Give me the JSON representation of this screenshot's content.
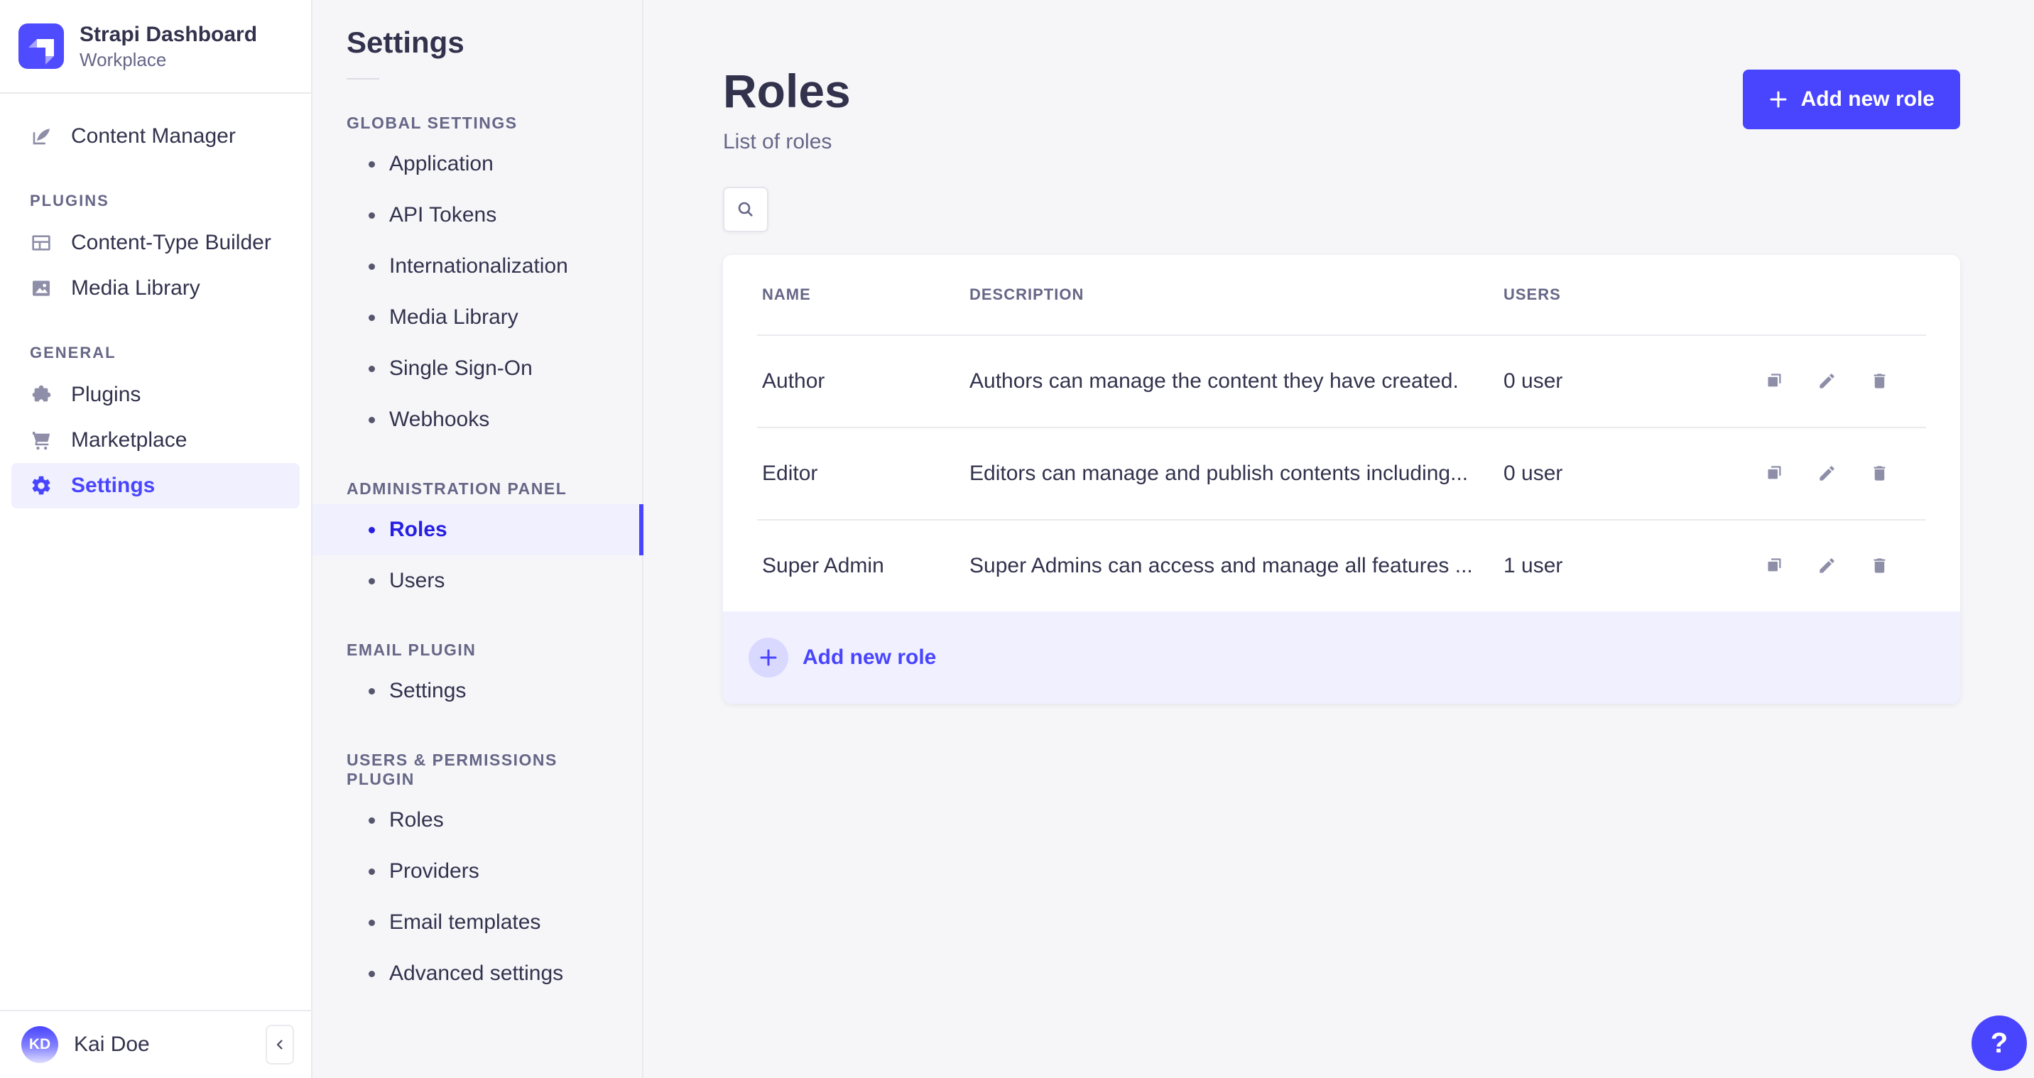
{
  "app": {
    "name": "Strapi Dashboard",
    "workspace": "Workplace"
  },
  "colors": {
    "accent": "#4945ff",
    "accent_active_text": "#271fe0",
    "accent_bg": "#f0f0ff",
    "accent_light": "#d9d8ff",
    "text": "#32324d",
    "text_secondary": "#666687",
    "icon": "#8e8ea9",
    "border": "#eaeaef",
    "page_bg": "#f6f6f9"
  },
  "sidebar": {
    "primary_item": {
      "label": "Content Manager",
      "icon": "pen-icon"
    },
    "sections": [
      {
        "label": "PLUGINS",
        "items": [
          {
            "label": "Content-Type Builder",
            "icon": "layout-icon"
          },
          {
            "label": "Media Library",
            "icon": "image-icon"
          }
        ]
      },
      {
        "label": "GENERAL",
        "items": [
          {
            "label": "Plugins",
            "icon": "puzzle-icon"
          },
          {
            "label": "Marketplace",
            "icon": "cart-icon"
          },
          {
            "label": "Settings",
            "icon": "gear-icon",
            "active": true
          }
        ]
      }
    ],
    "user": {
      "initials": "KD",
      "name": "Kai Doe"
    }
  },
  "subnav": {
    "title": "Settings",
    "sections": [
      {
        "label": "GLOBAL SETTINGS",
        "items": [
          "Application",
          "API Tokens",
          "Internationalization",
          "Media Library",
          "Single Sign-On",
          "Webhooks"
        ]
      },
      {
        "label": "ADMINISTRATION PANEL",
        "items": [
          "Roles",
          "Users"
        ],
        "active_item": "Roles"
      },
      {
        "label": "EMAIL PLUGIN",
        "items": [
          "Settings"
        ]
      },
      {
        "label": "USERS & PERMISSIONS PLUGIN",
        "items": [
          "Roles",
          "Providers",
          "Email templates",
          "Advanced settings"
        ]
      }
    ]
  },
  "main": {
    "title": "Roles",
    "subtitle": "List of roles",
    "add_button_label": "Add new role",
    "table": {
      "columns": [
        "NAME",
        "DESCRIPTION",
        "USERS"
      ],
      "rows": [
        {
          "name": "Author",
          "description": "Authors can manage the content they have created.",
          "users": "0 user"
        },
        {
          "name": "Editor",
          "description": "Editors can manage and publish contents including...",
          "users": "0 user"
        },
        {
          "name": "Super Admin",
          "description": "Super Admins can access and manage all features ...",
          "users": "1 user"
        }
      ],
      "footer_action_label": "Add new role"
    },
    "help_label": "?"
  }
}
